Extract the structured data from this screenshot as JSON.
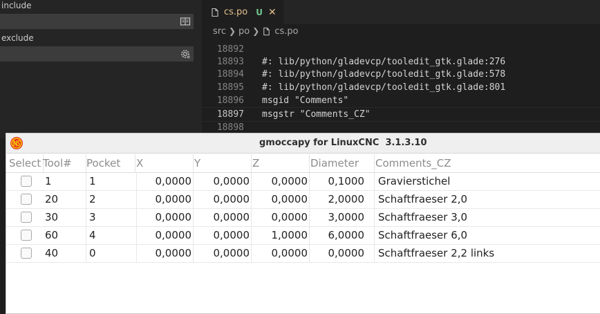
{
  "search": {
    "include_label": "include",
    "exclude_label": "exclude",
    "include_value": "",
    "exclude_value": ""
  },
  "editor": {
    "tab": {
      "filename": "cs.po",
      "status": "U"
    },
    "breadcrumb": [
      "src",
      "po",
      "cs.po"
    ],
    "lines": [
      {
        "no": "18892",
        "text": ""
      },
      {
        "no": "18893",
        "text": "#: lib/python/gladevcp/tooledit_gtk.glade:276"
      },
      {
        "no": "18894",
        "text": "#: lib/python/gladevcp/tooledit_gtk.glade:578"
      },
      {
        "no": "18895",
        "text": "#: lib/python/gladevcp/tooledit_gtk.glade:801"
      },
      {
        "no": "18896",
        "text": "msgid \"Comments\""
      },
      {
        "no": "18897",
        "text": "msgstr \"Comments_CZ\""
      },
      {
        "no": "18898",
        "text": ""
      }
    ],
    "current_line": "18897"
  },
  "tool_window": {
    "title": "gmoccapy for LinuxCNC  3.1.3.10",
    "columns": [
      "Select",
      "Tool#",
      "Pocket",
      "X",
      "Y",
      "Z",
      "Diameter",
      "Comments_CZ"
    ],
    "rows": [
      {
        "selected": false,
        "tool": "1",
        "pocket": "1",
        "x": "0,0000",
        "y": "0,0000",
        "z": "0,0000",
        "diameter": "0,1000",
        "comment": "Gravierstichel"
      },
      {
        "selected": false,
        "tool": "20",
        "pocket": "2",
        "x": "0,0000",
        "y": "0,0000",
        "z": "0,0000",
        "diameter": "2,0000",
        "comment": "Schaftfraeser 2,0"
      },
      {
        "selected": false,
        "tool": "30",
        "pocket": "3",
        "x": "0,0000",
        "y": "0,0000",
        "z": "0,0000",
        "diameter": "3,0000",
        "comment": "Schaftfraeser 3,0"
      },
      {
        "selected": false,
        "tool": "60",
        "pocket": "4",
        "x": "0,0000",
        "y": "0,0000",
        "z": "1,0000",
        "diameter": "6,0000",
        "comment": "Schaftfraeser 6,0"
      },
      {
        "selected": false,
        "tool": "40",
        "pocket": "0",
        "x": "0,0000",
        "y": "0,0000",
        "z": "0,0000",
        "diameter": "0,0000",
        "comment": "Schaftfraeser 2,2 links"
      }
    ]
  },
  "colors": {
    "vscode_background": "#1e1e1e",
    "untracked_file": "#e2c08d",
    "git_untracked_badge": "#73c991",
    "logo_circle": "#e8312a",
    "logo_ring": "#f5c400"
  },
  "icons": {
    "include_field": "book-icon",
    "exclude_field": "gear-settings-icon",
    "tab": "file-icon",
    "window": "linuxcnc-logo-icon"
  }
}
